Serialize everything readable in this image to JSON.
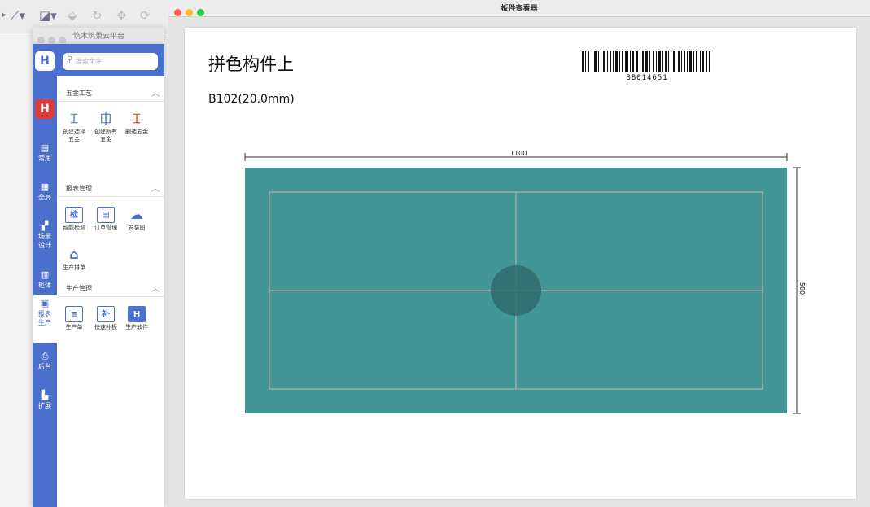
{
  "background_app": {
    "toolbar_icons": [
      "pen-icon",
      "rect-select-icon",
      "move-icon",
      "rotate-icon",
      "arrows-icon",
      "refresh-icon"
    ]
  },
  "palette": {
    "title": "筑木筑巢云平台",
    "logo": "H",
    "search_placeholder": "搜索命令",
    "rail": [
      {
        "label": "常用"
      },
      {
        "label": "全局"
      },
      {
        "label": "场景\n设计"
      },
      {
        "label": "柜体"
      },
      {
        "label": "报表\n生产"
      },
      {
        "label": "后台"
      },
      {
        "label": "扩展"
      }
    ],
    "sections": [
      {
        "title": "五金工艺",
        "tools": [
          {
            "label": "创建选择\n五金",
            "icon": "hardware-select-icon"
          },
          {
            "label": "创建所有\n五金",
            "icon": "hardware-all-icon"
          },
          {
            "label": "删选五金",
            "icon": "hardware-delete-icon"
          }
        ]
      },
      {
        "title": "报表管理",
        "tools": [
          {
            "label": "智能检测",
            "icon_text": "检"
          },
          {
            "label": "订单管理",
            "icon": "order-icon"
          },
          {
            "label": "安装图",
            "icon": "cloud-upload-icon"
          },
          {
            "label": "生产排单",
            "icon": "factory-icon"
          }
        ]
      },
      {
        "title": "生产管理",
        "tools": [
          {
            "label": "生产单",
            "icon": "production-sheet-icon"
          },
          {
            "label": "快速补板",
            "icon_text": "补"
          },
          {
            "label": "生产软件",
            "icon_text": "H"
          }
        ]
      }
    ]
  },
  "viewer": {
    "window_title": "板件查看器",
    "part_title": "拼色构件上",
    "material": "B102(20.0mm)",
    "barcode": "BB014651",
    "width_dimension": "1100",
    "height_dimension": "500",
    "board_color": "#439696",
    "line_color": "#c9b7a6",
    "hole_color": "#2f6b6b"
  }
}
